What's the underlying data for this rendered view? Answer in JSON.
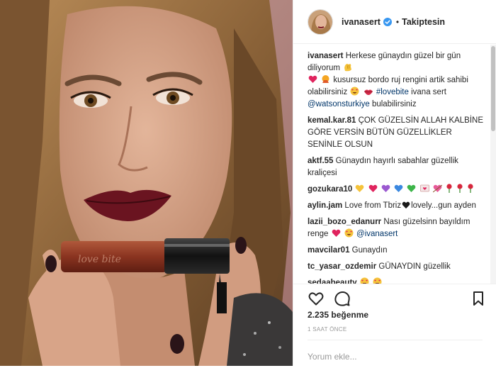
{
  "header": {
    "username": "ivanasert",
    "follow_status": "Takiptesin",
    "dot": "•"
  },
  "caption": {
    "username": "ivanasert",
    "part1": "Herkese günaydın güzel bir gün diliyorum",
    "part2": "kusursuz bordo ruj rengini artik sahibi olabilirsiniz",
    "hashtag": "#lovebite",
    "part3": "ivana sert",
    "mention": "@watsonsturkiye",
    "part4": "bulabilirsiniz"
  },
  "comments": [
    {
      "username": "kemal.kar.81",
      "text": "ÇOK GÜZELSİN ALLAH KALBİNE GÖRE VERSİN BÜTÜN GÜZELLİKLER SENİNLE OLSUN"
    },
    {
      "username": "aktf.55",
      "text": "Günaydın hayırlı sabahlar güzellik kraliçesi"
    },
    {
      "username": "gozukara10",
      "text": ""
    },
    {
      "username": "aylin.jam",
      "text_a": "Love from Tbriz",
      "text_b": "lovely...gun ayden"
    },
    {
      "username": "lazii_bozo_edanurr",
      "text": "Nası güzelsinn bayıldım renge",
      "mention": "@ivanasert"
    },
    {
      "username": "mavcilar01",
      "text": "Gunaydın"
    },
    {
      "username": "tc_yasar_ozdemir",
      "text": "GÜNAYDIN güzellik"
    },
    {
      "username": "sedaabeauty",
      "text": ""
    }
  ],
  "actions": {
    "likes": "2.235 beğenme",
    "time": "1 SAAT ÖNCE",
    "icons": [
      "heart-icon",
      "comment-icon",
      "bookmark-icon"
    ]
  },
  "comment_box": {
    "placeholder": "Yorum ekle..."
  },
  "colors": {
    "text": "#262626",
    "link": "#003569",
    "muted": "#999999",
    "verified": "#3897f0",
    "border": "#efefef"
  }
}
